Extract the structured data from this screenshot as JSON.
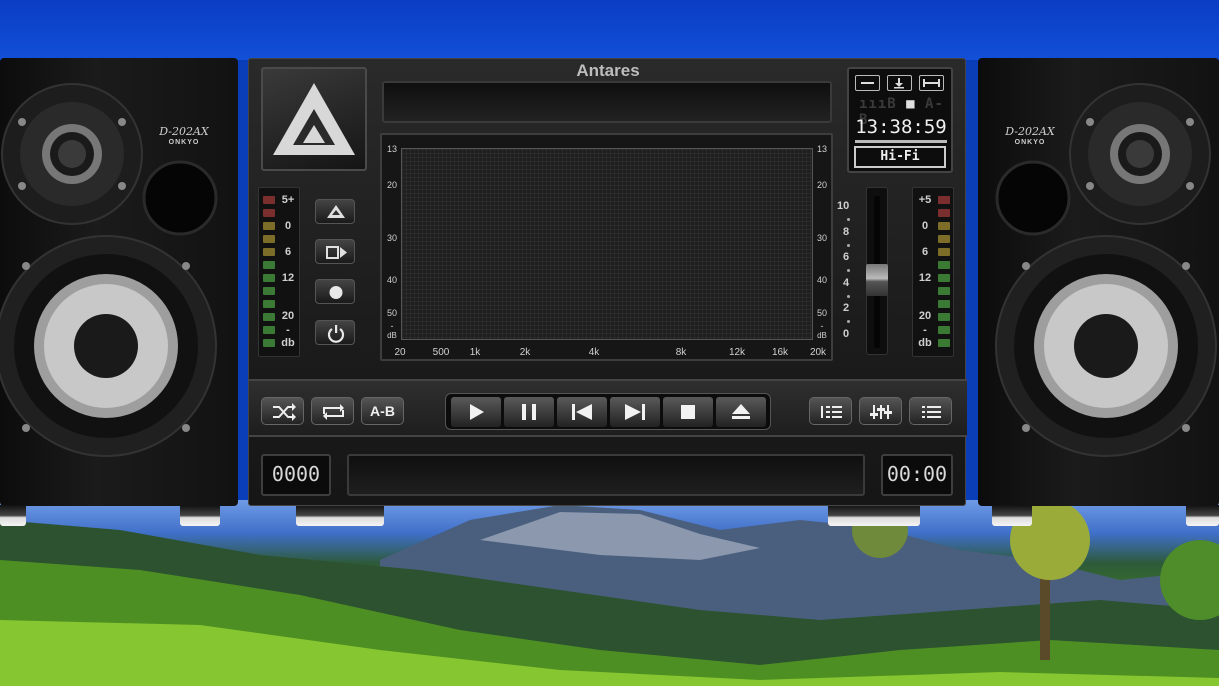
{
  "app": {
    "title": "Antares"
  },
  "info_panel": {
    "buttons": [
      {
        "icon": "minimize-icon"
      },
      {
        "icon": "download-icon"
      },
      {
        "icon": "compact-mode-icon"
      }
    ],
    "status_dim_left": "ıııB",
    "status_dim_right": "A-B",
    "clock": "13:38:59",
    "mode": "Hi-Fi"
  },
  "spectrum": {
    "y_labels": [
      "13",
      "20",
      "30",
      "40",
      "50",
      "-",
      "dB"
    ],
    "x_labels": [
      "20",
      "500",
      "1k",
      "2k",
      "4k",
      "8k",
      "12k",
      "16k",
      "20k"
    ]
  },
  "meters": {
    "left_labels": [
      "5+",
      "0",
      "6",
      "12",
      "20",
      "-",
      "db"
    ],
    "right_labels": [
      "+5",
      "0",
      "6",
      "12",
      "20",
      "-",
      "db"
    ]
  },
  "volume": {
    "labels": [
      "10",
      "8",
      "6",
      "4",
      "2",
      "0"
    ]
  },
  "side_controls": [
    {
      "icon": "eject-triangle-icon"
    },
    {
      "icon": "record-source-icon"
    },
    {
      "icon": "record-icon"
    },
    {
      "icon": "power-icon"
    }
  ],
  "transport": {
    "shuffle_icon": "shuffle-icon",
    "repeat_icon": "repeat-icon",
    "ab_label": "A-B",
    "play_icon": "play-icon",
    "pause_icon": "pause-icon",
    "prev_icon": "previous-icon",
    "next_icon": "next-icon",
    "stop_icon": "stop-icon",
    "eject_icon": "eject-icon",
    "right_icons": [
      "playlist-edit-icon",
      "equalizer-icon",
      "playlist-icon"
    ]
  },
  "bottom": {
    "track_counter": "0000",
    "time": "00:00"
  },
  "speakers": {
    "model": "D-202AX",
    "brand": "ONKYO"
  },
  "colors": {
    "meter_red": "#8a3a3a",
    "meter_yellow": "#8a7a2a",
    "meter_green": "#3f8a3a"
  }
}
